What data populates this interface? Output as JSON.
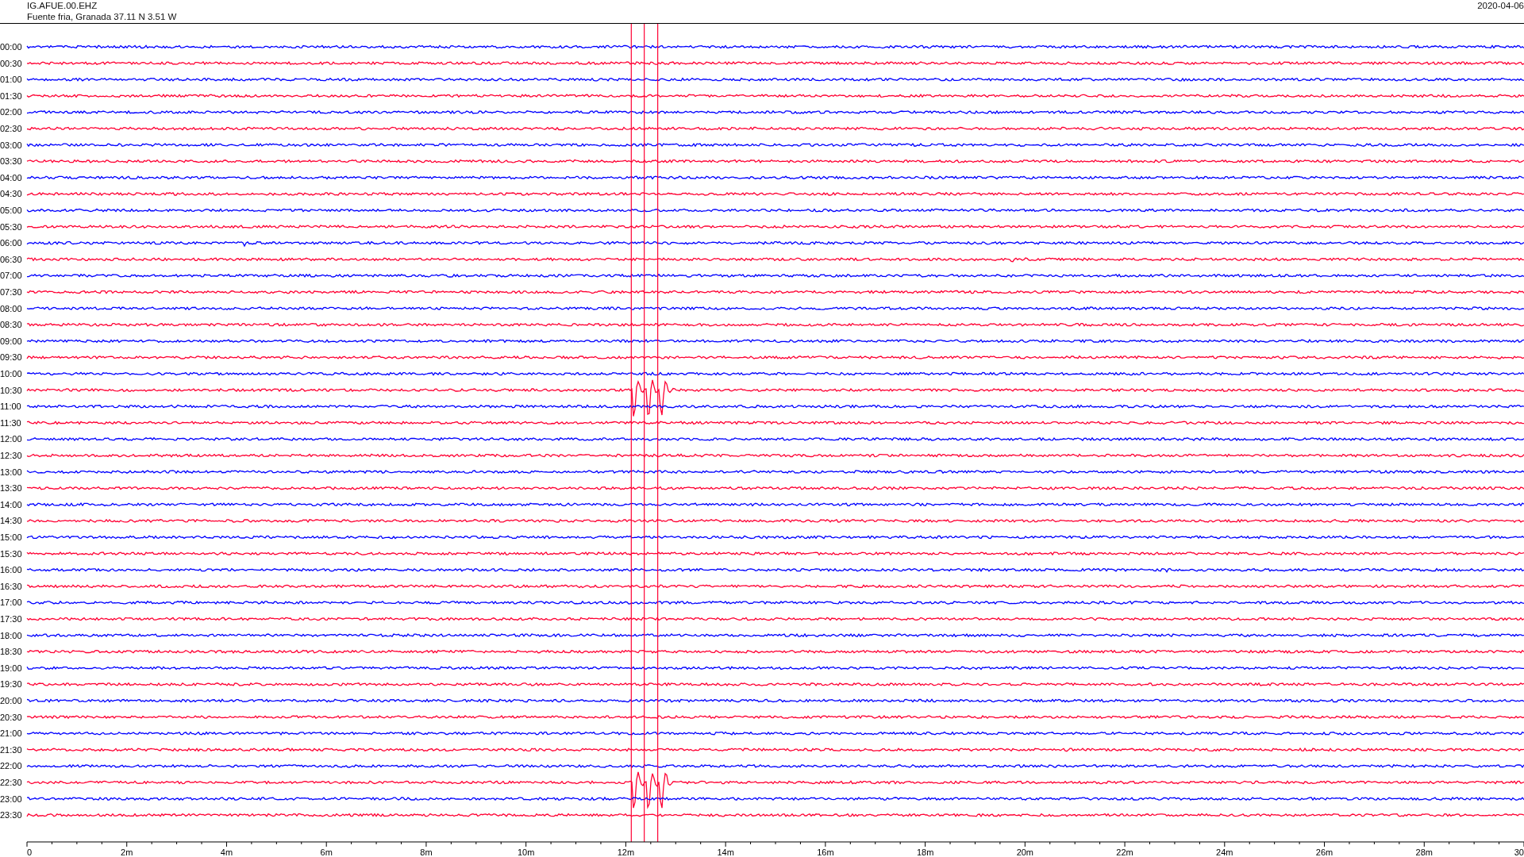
{
  "header": {
    "station": "IG.AFUE.00.EHZ",
    "location": "Fuente fria, Granada  37.11 N 3.51 W",
    "date": "2020-04-06"
  },
  "rows": [
    {
      "label": "00:00",
      "color": "#0000ff"
    },
    {
      "label": "00:30",
      "color": "#ff0033"
    },
    {
      "label": "01:00",
      "color": "#0000ff"
    },
    {
      "label": "01:30",
      "color": "#ff0033"
    },
    {
      "label": "02:00",
      "color": "#0000ff"
    },
    {
      "label": "02:30",
      "color": "#ff0033"
    },
    {
      "label": "03:00",
      "color": "#0000ff"
    },
    {
      "label": "03:30",
      "color": "#ff0033"
    },
    {
      "label": "04:00",
      "color": "#0000ff"
    },
    {
      "label": "04:30",
      "color": "#ff0033"
    },
    {
      "label": "05:00",
      "color": "#0000ff"
    },
    {
      "label": "05:30",
      "color": "#ff0033"
    },
    {
      "label": "06:00",
      "color": "#0000ff"
    },
    {
      "label": "06:30",
      "color": "#ff0033"
    },
    {
      "label": "07:00",
      "color": "#0000ff"
    },
    {
      "label": "07:30",
      "color": "#ff0033"
    },
    {
      "label": "08:00",
      "color": "#0000ff"
    },
    {
      "label": "08:30",
      "color": "#ff0033"
    },
    {
      "label": "09:00",
      "color": "#0000ff"
    },
    {
      "label": "09:30",
      "color": "#ff0033"
    },
    {
      "label": "10:00",
      "color": "#0000ff"
    },
    {
      "label": "10:30",
      "color": "#ff0033"
    },
    {
      "label": "11:00",
      "color": "#0000ff"
    },
    {
      "label": "11:30",
      "color": "#ff0033"
    },
    {
      "label": "12:00",
      "color": "#0000ff"
    },
    {
      "label": "12:30",
      "color": "#ff0033"
    },
    {
      "label": "13:00",
      "color": "#0000ff"
    },
    {
      "label": "13:30",
      "color": "#ff0033"
    },
    {
      "label": "14:00",
      "color": "#0000ff"
    },
    {
      "label": "14:30",
      "color": "#ff0033"
    },
    {
      "label": "15:00",
      "color": "#0000ff"
    },
    {
      "label": "15:30",
      "color": "#ff0033"
    },
    {
      "label": "16:00",
      "color": "#0000ff"
    },
    {
      "label": "16:30",
      "color": "#ff0033"
    },
    {
      "label": "17:00",
      "color": "#0000ff"
    },
    {
      "label": "17:30",
      "color": "#ff0033"
    },
    {
      "label": "18:00",
      "color": "#0000ff"
    },
    {
      "label": "18:30",
      "color": "#ff0033"
    },
    {
      "label": "19:00",
      "color": "#0000ff"
    },
    {
      "label": "19:30",
      "color": "#ff0033"
    },
    {
      "label": "20:00",
      "color": "#0000ff"
    },
    {
      "label": "20:30",
      "color": "#ff0033"
    },
    {
      "label": "21:00",
      "color": "#0000ff"
    },
    {
      "label": "21:30",
      "color": "#ff0033"
    },
    {
      "label": "22:00",
      "color": "#0000ff"
    },
    {
      "label": "22:30",
      "color": "#ff0033"
    },
    {
      "label": "23:00",
      "color": "#0000ff"
    },
    {
      "label": "23:30",
      "color": "#ff0033"
    }
  ],
  "x_ticks": [
    "0",
    "2m",
    "4m",
    "6m",
    "8m",
    "10m",
    "12m",
    "14m",
    "16m",
    "18m",
    "20m",
    "22m",
    "24m",
    "26m",
    "28m",
    "30"
  ]
}
